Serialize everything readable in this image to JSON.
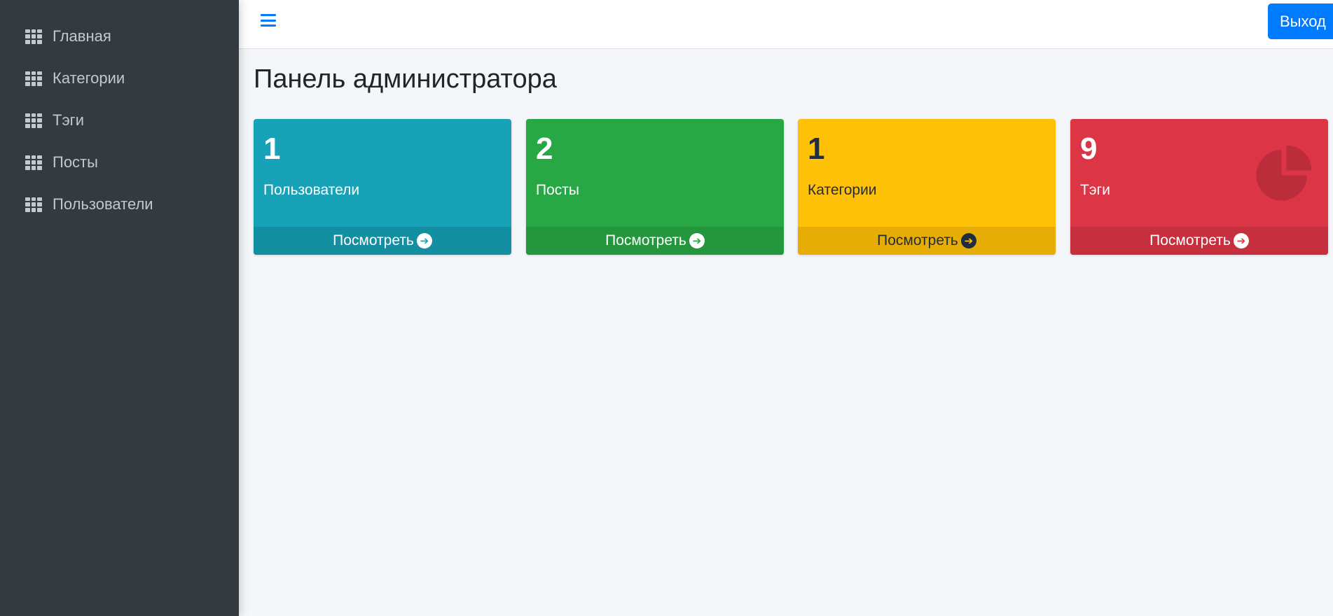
{
  "sidebar": {
    "items": [
      {
        "label": "Главная",
        "icon": "grid-icon"
      },
      {
        "label": "Категории",
        "icon": "grid-icon"
      },
      {
        "label": "Тэги",
        "icon": "grid-icon"
      },
      {
        "label": "Посты",
        "icon": "grid-icon"
      },
      {
        "label": "Пользователи",
        "icon": "grid-icon"
      }
    ]
  },
  "topbar": {
    "menu_icon": "hamburger-icon",
    "logout_label": "Выход"
  },
  "main": {
    "title": "Панель администратора",
    "cards": [
      {
        "count": "1",
        "label": "Пользователи",
        "link": "Посмотреть",
        "color": "#17a2b8",
        "arrow_icon": "arrow-circle-right-icon"
      },
      {
        "count": "2",
        "label": "Посты",
        "link": "Посмотреть",
        "color": "#28a745",
        "arrow_icon": "arrow-circle-right-icon"
      },
      {
        "count": "1",
        "label": "Категории",
        "link": "Посмотреть",
        "color": "#ffc107",
        "arrow_icon": "arrow-circle-right-icon"
      },
      {
        "count": "9",
        "label": "Тэги",
        "link": "Посмотреть",
        "color": "#dc3545",
        "arrow_icon": "arrow-circle-right-icon",
        "bg_icon": "pie-chart-icon"
      }
    ]
  },
  "colors": {
    "sidebar_bg": "#343a40",
    "sidebar_text": "#c2c7d0",
    "primary": "#007bff",
    "page_bg": "#f4f6f9"
  }
}
